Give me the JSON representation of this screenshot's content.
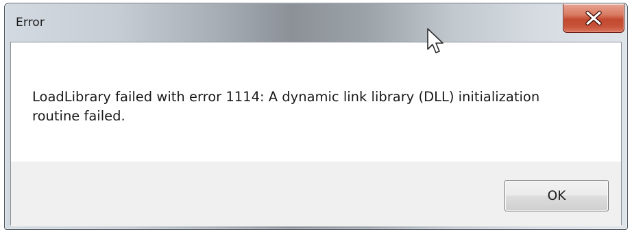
{
  "window": {
    "title": "Error",
    "close_icon": "close-icon",
    "close_button_color": "#c7503a"
  },
  "dialog": {
    "message": "LoadLibrary failed with error 1114: A dynamic link library (DLL) initialization\nroutine failed.",
    "ok_label": "OK"
  },
  "cursor": {
    "icon": "mouse-pointer-icon"
  }
}
